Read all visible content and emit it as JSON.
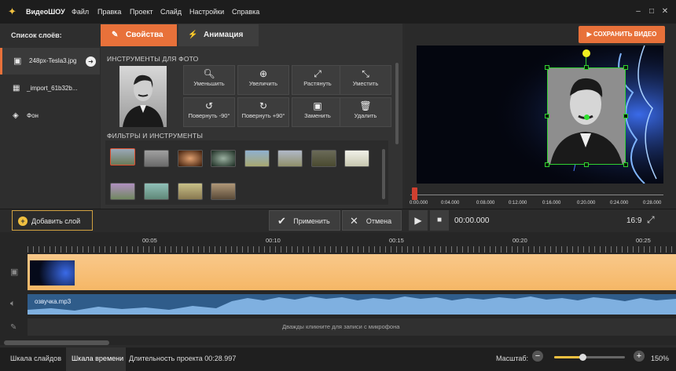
{
  "app": {
    "title": "ВидеоШОУ"
  },
  "menu": [
    "Файл",
    "Правка",
    "Проект",
    "Слайд",
    "Настройки",
    "Справка"
  ],
  "layers": {
    "header": "Список слоёв:",
    "items": [
      "248px-Tesla3.jpg",
      "_import_61b32b...",
      "Фон"
    ]
  },
  "tabs": {
    "properties": "Свойства",
    "animation": "Анимация"
  },
  "photo_tools": {
    "header": "ИНСТРУМЕНТЫ ДЛЯ ФОТО",
    "buttons": [
      "Уменьшить",
      "Увеличить",
      "Растянуть",
      "Уместить",
      "Повернуть -90°",
      "Повернуть +90°",
      "Заменить",
      "Удалить"
    ]
  },
  "filters": {
    "header": "ФИЛЬТРЫ И ИНСТРУМЕНТЫ"
  },
  "save_button": "СОХРАНИТЬ ВИДЕО",
  "preview_ruler": [
    "0:00.000",
    "0:04.000",
    "0:08.000",
    "0:12.000",
    "0:16.000",
    "0:20.000",
    "0:24.000",
    "0:28.000"
  ],
  "controls": {
    "add_layer": "Добавить слой",
    "apply": "Применить",
    "cancel": "Отмена",
    "time": "00:00.000",
    "aspect": "16:9"
  },
  "timeline": {
    "ticks": [
      "00:05",
      "00:10",
      "00:15",
      "00:20",
      "00:25"
    ],
    "audio_label": "озвучка.mp3",
    "mic_hint": "Дважды кликните для записи с микрофона"
  },
  "bottom": {
    "slides_tab": "Шкала слайдов",
    "timeline_tab": "Шкала времени",
    "duration": "Длительность проекта 00:28.997",
    "zoom_label": "Масштаб:",
    "zoom_value": "150%",
    "zoom_level": 0.4
  },
  "colors": {
    "accent": "#e8713a",
    "timeline_track": "#f7c07a",
    "audio": "#4c7fb8"
  }
}
